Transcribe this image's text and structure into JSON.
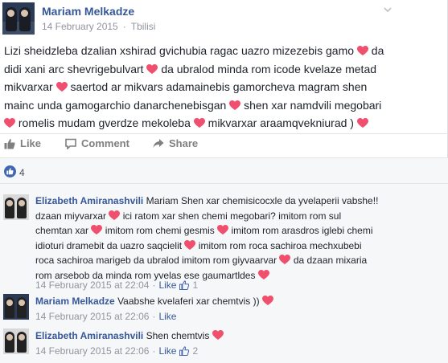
{
  "post": {
    "author": "Mariam Melkadze",
    "date": "14 February 2015",
    "separator": "·",
    "location": "Tbilisi",
    "lines": [
      "Lizi sheidzleba dzalian xshirad gvichubia ragac uazro mizezebis gamo",
      "da",
      "didi xani arc shevrigebulvart",
      "da ubralod minda rom icode kvelaze metad",
      "mikvarxar",
      "saertod ar mikvars adamainebis gamorcheva magram shen",
      "mainc unda gamogarchio danarchenebisgan",
      "shen xar namdvili megobari",
      "romelis mudam gverdze mekoleba",
      "mikvarxar araamqvekniurad )"
    ]
  },
  "actions": {
    "like": "Like",
    "comment": "Comment",
    "share": "Share"
  },
  "likes": {
    "count": "4"
  },
  "comments": [
    {
      "author": "Elizabeth Amiranashvili",
      "segments": [
        "Mariam Shen xar chemisicocxle da yvelaperii vabshe!!",
        "dzaan miyvarxar",
        "ici ratom xar shen chemi megobari? imitom rom sul",
        "chemtan xar",
        "imitom rom chemi gesmis",
        "imitom rom arasdros iglebi chemi",
        "idioturi dramebit da uazro saqcielit",
        "imitom rom roca sachiroa mechxubebi",
        "roca sachiroa marigeb da ubralod imitom rom giyvaarvar",
        "da dzaan mixaria",
        "rom arsebob da minda rom yvelas ese gaumartldes"
      ],
      "date": "14 February 2015 at 22:04",
      "like_label": "Like",
      "like_count": "1"
    },
    {
      "author": "Mariam Melkadze",
      "text": "Vaabshe kvelaferi xar chemtvis ))",
      "date": "14 February 2015 at 22:06",
      "like_label": "Like",
      "dot": "·"
    },
    {
      "author": "Elizabeth Amiranashvili",
      "text": "Shen chemtvis",
      "date": "14 February 2015 at 22:06",
      "like_label": "Like",
      "like_count": "2"
    }
  ],
  "colors": {
    "link": "#365899",
    "heart": "#f0506e",
    "like_blue": "#4267b2"
  }
}
